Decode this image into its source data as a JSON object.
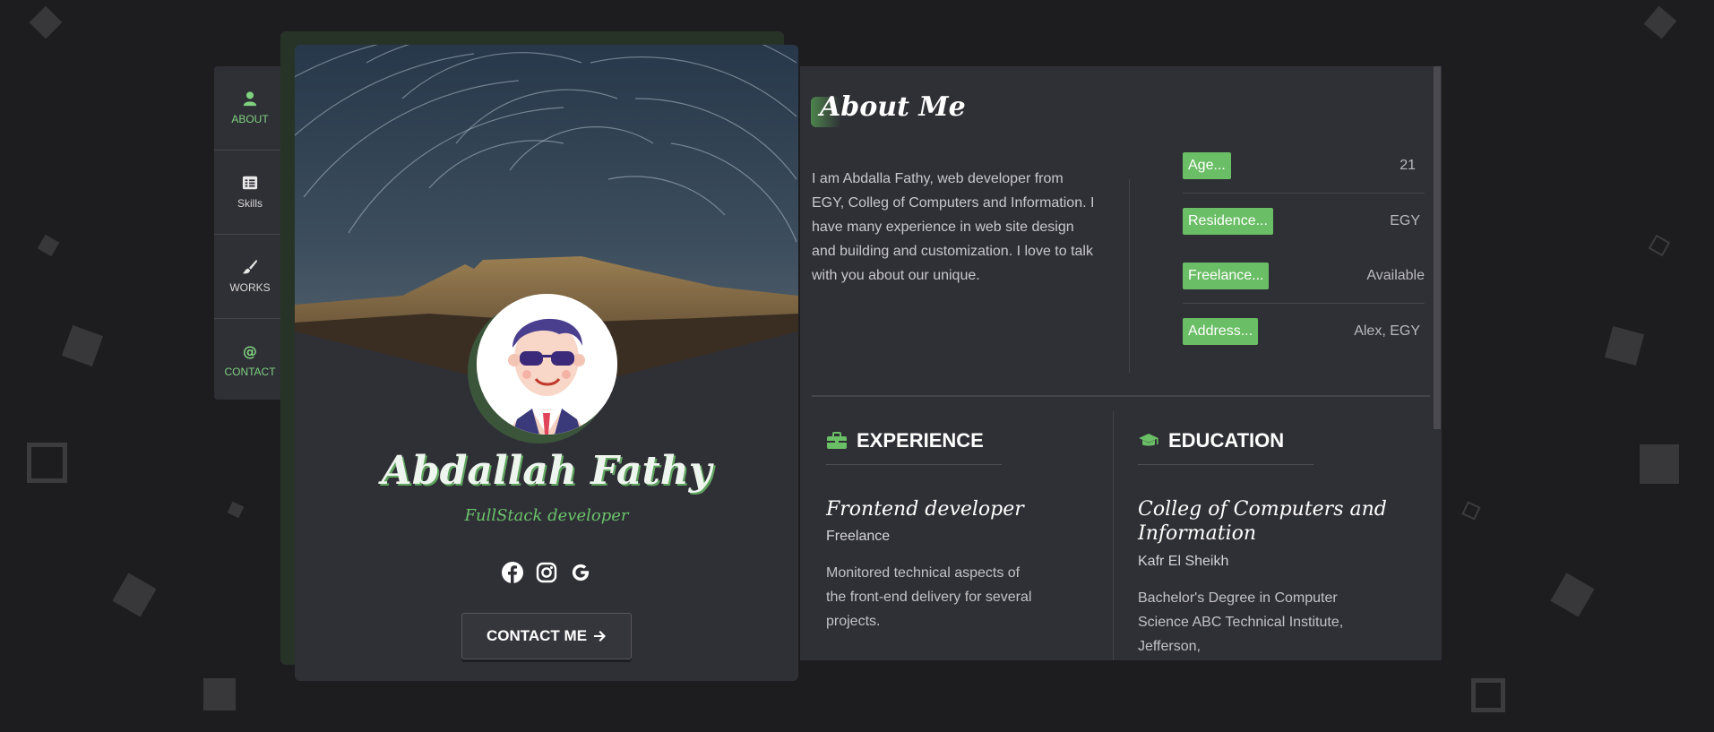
{
  "nav": {
    "items": [
      {
        "label": "ABOUT",
        "icon": "user-icon",
        "active": true
      },
      {
        "label": "Skills",
        "icon": "list-icon",
        "active": false
      },
      {
        "label": "WORKS",
        "icon": "brush-icon",
        "active": false
      },
      {
        "label": "CONTACT",
        "icon": "at-icon",
        "active": true
      }
    ]
  },
  "profile": {
    "name": "Abdallah Fathy",
    "role": "FullStack developer",
    "socials": [
      "facebook-icon",
      "instagram-icon",
      "google-icon"
    ],
    "contact_label": "CONTACT ME",
    "contact_icon": "arrow-right-icon"
  },
  "about": {
    "title": "About Me",
    "text": "I am Abdalla Fathy, web developer from EGY, Colleg of Computers and Information. I have many experience in web site design and building and customization. I love to talk with you about our unique.",
    "info": [
      {
        "key": "Age...",
        "value": "21"
      },
      {
        "key": "Residence...",
        "value": "EGY"
      },
      {
        "key": "Freelance...",
        "value": "Available"
      },
      {
        "key": "Address...",
        "value": "Alex, EGY"
      }
    ]
  },
  "experience": {
    "heading": "EXPERIENCE",
    "icon": "briefcase-icon",
    "title": "Frontend developer",
    "subtitle": "Freelance",
    "description": "Monitored technical aspects of the front-end delivery for several projects."
  },
  "education": {
    "heading": "EDUCATION",
    "icon": "graduation-cap-icon",
    "title": "Colleg of Computers and Information",
    "subtitle": "Kafr El Sheikh",
    "description": "Bachelor's Degree in Computer Science ABC Technical Institute, Jefferson,"
  },
  "colors": {
    "accent": "#6abe65",
    "background": "#1d1d1f",
    "panel": "#2f2f36"
  }
}
